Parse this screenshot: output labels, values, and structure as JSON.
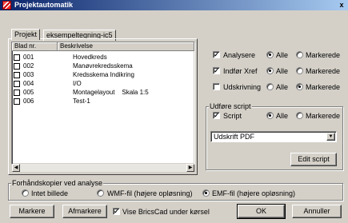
{
  "window": {
    "title": "Projektautomatik",
    "close_label": "x"
  },
  "tabs": [
    {
      "label": "Projekt"
    },
    {
      "label": "eksempeltegning-ic5"
    }
  ],
  "list": {
    "columns": [
      "Blad nr.",
      "Beskrivelse"
    ],
    "rows": [
      {
        "nr": "001",
        "desc": "Hovedkreds"
      },
      {
        "nr": "002",
        "desc": "Manøvrekredsskema"
      },
      {
        "nr": "003",
        "desc": "Kredsskema Indikring"
      },
      {
        "nr": "004",
        "desc": "I/O"
      },
      {
        "nr": "005",
        "desc": "Montagelayout    Skala 1:5"
      },
      {
        "nr": "006",
        "desc": "Test-1"
      }
    ]
  },
  "options": {
    "analysere": {
      "label": "Analysere",
      "checked": true,
      "alle": "Alle",
      "markerede": "Markerede",
      "selected": "alle"
    },
    "indfor": {
      "label": "Indfør Xref",
      "checked": true,
      "alle": "Alle",
      "markerede": "Markerede",
      "selected": "alle"
    },
    "udskrivning": {
      "label": "Udskrivning",
      "checked": false,
      "alle": "Alle",
      "markerede": "Markerede",
      "selected": "markerede"
    }
  },
  "script_group": {
    "title": "Udføre script",
    "script": {
      "label": "Script",
      "checked": true,
      "alle": "Alle",
      "markerede": "Markerede",
      "selected": "alle"
    },
    "dropdown_value": "Udskrift PDF",
    "edit_label": "Edit script"
  },
  "preview_group": {
    "title": "Forhåndskopier ved analyse",
    "options": [
      {
        "label": "Intet billede",
        "selected": false
      },
      {
        "label": "WMF-fil (højere opløsning)",
        "selected": false
      },
      {
        "label": "EMF-fil (højere opløsning)",
        "selected": true
      }
    ]
  },
  "footer": {
    "markere": "Markere",
    "afmarkere": "Afmarkere",
    "vise_label": "Vise BricsCad under kørsel",
    "vise_checked": true,
    "ok": "OK",
    "annuller": "Annuller"
  },
  "icons": {
    "app": "projekt-automation-icon",
    "close": "close-icon",
    "scroll_left": "arrow-left-icon",
    "scroll_right": "arrow-right-icon",
    "dropdown": "chevron-down-icon"
  }
}
